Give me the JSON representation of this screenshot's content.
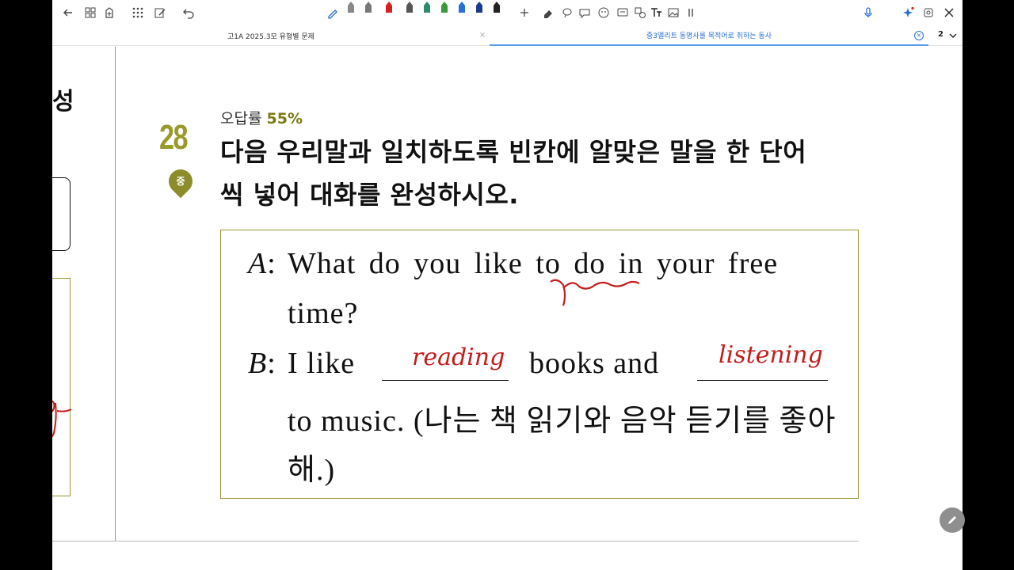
{
  "tabs": [
    {
      "label": "고1A 2025.3모 유형별 문제",
      "active": false
    },
    {
      "label": "중3엘리트 동명사를 목적어로 취하는 동사",
      "active": true
    }
  ],
  "tab_count": "2",
  "left_panel": {
    "heading": "성"
  },
  "question": {
    "number": "28",
    "level": "중",
    "error_rate_label": "오답률",
    "error_rate_value": "55%",
    "instruction_line1": "다음 우리말과 일치하도록 빈칸에 알맞은 말을 한 단어",
    "instruction_line2": "씩 넣어 대화를 완성하시오."
  },
  "dialog": {
    "a_speaker": "A",
    "a_colon": ":",
    "a_line1": "What do you like to do in your free",
    "a_line2": "time?",
    "b_speaker": "B",
    "b_colon": ":",
    "b_start": "I like",
    "b_mid": "books and",
    "b_line2": "to music. (나는 책 읽기와 음악 듣기를 좋아",
    "b_line3": "해.)"
  },
  "handwriting": {
    "blank1": "reading",
    "blank2": "listening"
  },
  "colors": {
    "accent_olive": "#9a9a2a",
    "ink_red": "#c41c1c",
    "tab_blue": "#2a6fd6"
  },
  "icons": {
    "back": "back-arrow-icon",
    "grid": "grid-icon",
    "undo": "undo-icon",
    "mic": "microphone-icon",
    "sparkle": "sparkle-icon",
    "edit_fab": "pencil-icon"
  }
}
